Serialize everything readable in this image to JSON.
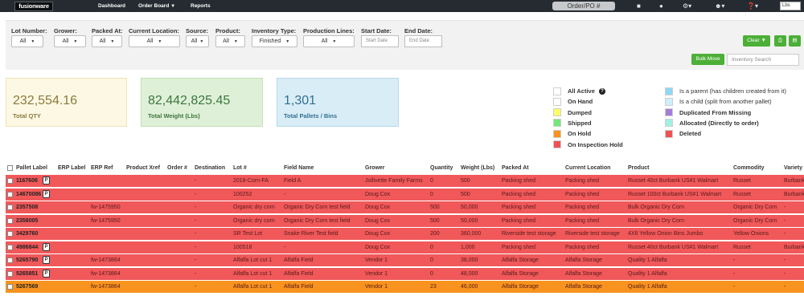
{
  "nav": {
    "logo": "fusionware",
    "links": [
      "Dashboard",
      "Order Board",
      "Reports"
    ],
    "order_search_placeholder": "Order/PO #",
    "unit": "Lbs"
  },
  "filters": {
    "lot_number": {
      "label": "Lot Number:",
      "value": "All"
    },
    "grower": {
      "label": "Grower:",
      "value": "All"
    },
    "packed_at": {
      "label": "Packed At:",
      "value": "All"
    },
    "current_location": {
      "label": "Current Location:",
      "value": "All"
    },
    "source": {
      "label": "Source:",
      "value": "All"
    },
    "product": {
      "label": "Product:",
      "value": "All"
    },
    "inventory_type": {
      "label": "Inventory Type:",
      "value": "Finished"
    },
    "production_lines": {
      "label": "Production Lines:",
      "value": "All"
    },
    "start_date": {
      "label": "Start Date:",
      "placeholder": "Start Date"
    },
    "end_date": {
      "label": "End Date:",
      "placeholder": "End Date"
    },
    "clear_label": "Clear",
    "bulk_move_label": "Bulk Move",
    "inventory_search_placeholder": "Inventory Search"
  },
  "stats": [
    {
      "value": "232,554.16",
      "label": "Total QTY",
      "bg": "#fdf8e4",
      "border": "#f0e4b8",
      "color": "#8a7a3c"
    },
    {
      "value": "82,442,825.45",
      "label": "Total Weight (Lbs)",
      "bg": "#dff0d8",
      "border": "#c6dfb5",
      "color": "#3c763d"
    },
    {
      "value": "1,301",
      "label": "Total Pallets / Bins",
      "bg": "#d9edf7",
      "border": "#b7d8ea",
      "color": "#31708f"
    }
  ],
  "legend": [
    {
      "label": "All Active",
      "color": "#ffffff",
      "bold": true
    },
    {
      "label": "On Hand",
      "color": "#ffffff",
      "bold": true
    },
    {
      "label": "Dumped",
      "color": "#fffe6b",
      "bold": true
    },
    {
      "label": "Shipped",
      "color": "#74e67a",
      "bold": true
    },
    {
      "label": "On Hold",
      "color": "#f7931e",
      "bold": true
    },
    {
      "label": "On Inspection Hold",
      "color": "#ee5252",
      "bold": true
    },
    {
      "label": "Is a parent (has children created from it)",
      "color": "#8fd7f5",
      "bold": false
    },
    {
      "label": "Is a child (split from another pallet)",
      "color": "#cfeffa",
      "bold": false
    },
    {
      "label": "Duplicated From Missing",
      "color": "#a27ed8",
      "bold": true
    },
    {
      "label": "Allocated (Directly to order)",
      "color": "#a2f0e2",
      "bold": true
    },
    {
      "label": "Deleted",
      "color": "#ee5252",
      "bold": true
    }
  ],
  "colors": {
    "row_red": "#f0585a",
    "row_orange": "#f7931e"
  },
  "table": {
    "headers": [
      "Pallet Label",
      "ERP Label",
      "ERP Ref",
      "Product Xref",
      "Order #",
      "Destination",
      "Lot #",
      "Field Name",
      "Grower",
      "Quantity",
      "Weight (Lbs)",
      "Packed At",
      "Current Location",
      "Product",
      "Commodity",
      "Variety"
    ],
    "rows": [
      {
        "pallet": "1167606",
        "p": true,
        "erp_ref": "",
        "dest": "-",
        "lot": "2018-Corn-FA",
        "field": "Field A",
        "grower": "Jollivette Family Farms",
        "qty": "0",
        "weight": "500",
        "packed": "Packing shed",
        "location": "Packing shed",
        "product": "Russet 40ct Burbank US#1 Walmart",
        "commodity": "Russet",
        "variety": "Burbank",
        "color": "red"
      },
      {
        "pallet": "14670086",
        "p": true,
        "erp_ref": "",
        "dest": "-",
        "lot": "100252",
        "field": "-",
        "grower": "Doug Cox",
        "qty": "0",
        "weight": "500",
        "packed": "Packing shed",
        "location": "Packing shed",
        "product": "Russet 100ct Burbank US#1 Walmart",
        "commodity": "Russet",
        "variety": "Burbank",
        "color": "red"
      },
      {
        "pallet": "2357508",
        "p": false,
        "erp_ref": "fw-1475950",
        "dest": "-",
        "lot": "Organic dry corn",
        "field": "Organic Dry Corn test field",
        "grower": "Doug Cox",
        "qty": "500",
        "weight": "50,000",
        "packed": "Packing shed",
        "location": "Packing shed",
        "product": "Bulk Organic Dry Corn",
        "commodity": "Organic Dry Corn",
        "variety": "-",
        "color": "red"
      },
      {
        "pallet": "2358005",
        "p": false,
        "erp_ref": "fw-1475950",
        "dest": "-",
        "lot": "Organic dry corn",
        "field": "Organic Dry Corn test field",
        "grower": "Doug Cox",
        "qty": "500",
        "weight": "50,000",
        "packed": "Packing shed",
        "location": "Packing shed",
        "product": "Bulk Organic Dry Corn",
        "commodity": "Organic Dry Corn",
        "variety": "-",
        "color": "red"
      },
      {
        "pallet": "3429760",
        "p": false,
        "erp_ref": "",
        "dest": "-",
        "lot": "SR Test Lot",
        "field": "Snake River Test field",
        "grower": "Doug Cox",
        "qty": "200",
        "weight": "360,000",
        "packed": "Riverside test storage",
        "location": "Riverside test storage",
        "product": "4X6 Yellow Onion Bins Jumbo",
        "commodity": "Yellow Onions",
        "variety": "-",
        "color": "red"
      },
      {
        "pallet": "4986844",
        "p": true,
        "erp_ref": "",
        "dest": "-",
        "lot": "100518",
        "field": "-",
        "grower": "Doug Cox",
        "qty": "0",
        "weight": "1,000",
        "packed": "Packing shed",
        "location": "Packing shed",
        "product": "Russet 40ct Burbank US#1 Walmart",
        "commodity": "Russet",
        "variety": "Burbank",
        "color": "red"
      },
      {
        "pallet": "5265790",
        "p": true,
        "erp_ref": "fw-1473864",
        "dest": "-",
        "lot": "Alfalfa Lot cut 1",
        "field": "Alfalfa Field",
        "grower": "Vendor 1",
        "qty": "0",
        "weight": "38,000",
        "packed": "Alfalfa Storage",
        "location": "Alfalfa Storage",
        "product": "Quality 1 Alfalfa",
        "commodity": "-",
        "variety": "-",
        "color": "red"
      },
      {
        "pallet": "5265851",
        "p": true,
        "erp_ref": "fw-1473864",
        "dest": "-",
        "lot": "Alfalfa Lot cut 1",
        "field": "Alfalfa Field",
        "grower": "Vendor 1",
        "qty": "0",
        "weight": "48,000",
        "packed": "Alfalfa Storage",
        "location": "Alfalfa Storage",
        "product": "Quality 1 Alfalfa",
        "commodity": "-",
        "variety": "-",
        "color": "red"
      },
      {
        "pallet": "5267569",
        "p": false,
        "erp_ref": "fw-1473864",
        "dest": "-",
        "lot": "Alfalfa Lot cut 1",
        "field": "Alfalfa Field",
        "grower": "Vendor 1",
        "qty": "23",
        "weight": "46,000",
        "packed": "Alfalfa Storage",
        "location": "Alfalfa Storage",
        "product": "Quality 1 Alfalfa",
        "commodity": "-",
        "variety": "-",
        "color": "orange"
      }
    ]
  }
}
